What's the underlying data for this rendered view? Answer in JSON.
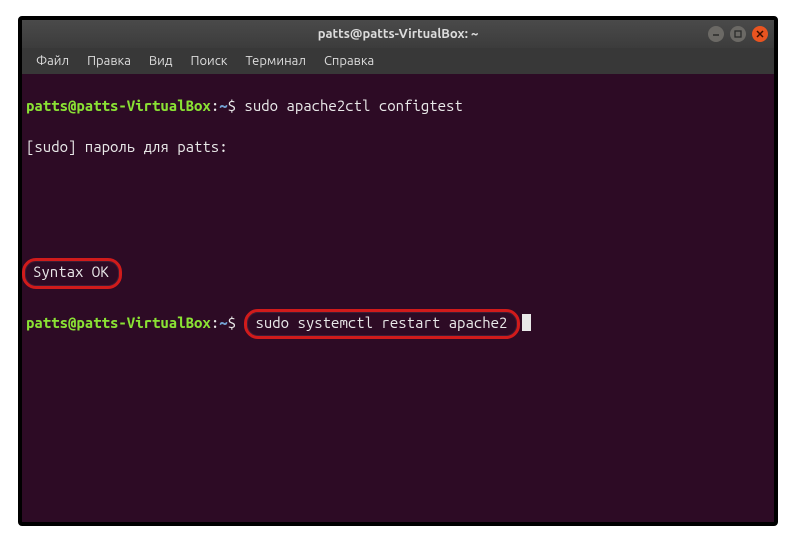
{
  "titlebar": {
    "title": "patts@patts-VirtualBox: ~"
  },
  "menubar": {
    "items": [
      {
        "label": "Файл"
      },
      {
        "label": "Правка"
      },
      {
        "label": "Вид"
      },
      {
        "label": "Поиск"
      },
      {
        "label": "Терминал"
      },
      {
        "label": "Справка"
      }
    ]
  },
  "terminal": {
    "prompt_user_host": "patts@patts-VirtualBox",
    "prompt_colon": ":",
    "prompt_path": "~",
    "prompt_sym": "$",
    "line1_cmd": " sudo apache2ctl configtest",
    "line2_text": "[sudo] пароль для patts:",
    "line3_blank": " ",
    "line4_blank": " ",
    "line5_syntax": "Syntax OK",
    "line6_cmd": "sudo systemctl restart apache2"
  }
}
